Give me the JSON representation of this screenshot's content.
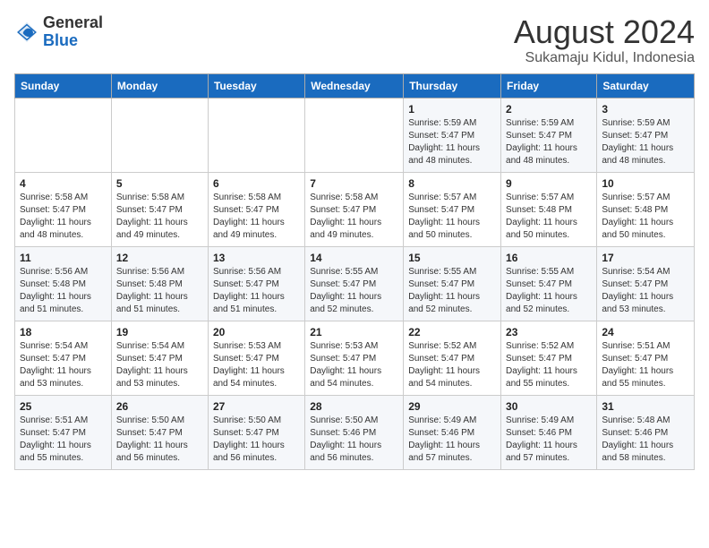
{
  "header": {
    "logo_general": "General",
    "logo_blue": "Blue",
    "month_year": "August 2024",
    "location": "Sukamaju Kidul, Indonesia"
  },
  "days_of_week": [
    "Sunday",
    "Monday",
    "Tuesday",
    "Wednesday",
    "Thursday",
    "Friday",
    "Saturday"
  ],
  "weeks": [
    [
      {
        "day": "",
        "info": ""
      },
      {
        "day": "",
        "info": ""
      },
      {
        "day": "",
        "info": ""
      },
      {
        "day": "",
        "info": ""
      },
      {
        "day": "1",
        "info": "Sunrise: 5:59 AM\nSunset: 5:47 PM\nDaylight: 11 hours and 48 minutes."
      },
      {
        "day": "2",
        "info": "Sunrise: 5:59 AM\nSunset: 5:47 PM\nDaylight: 11 hours and 48 minutes."
      },
      {
        "day": "3",
        "info": "Sunrise: 5:59 AM\nSunset: 5:47 PM\nDaylight: 11 hours and 48 minutes."
      }
    ],
    [
      {
        "day": "4",
        "info": "Sunrise: 5:58 AM\nSunset: 5:47 PM\nDaylight: 11 hours and 48 minutes."
      },
      {
        "day": "5",
        "info": "Sunrise: 5:58 AM\nSunset: 5:47 PM\nDaylight: 11 hours and 49 minutes."
      },
      {
        "day": "6",
        "info": "Sunrise: 5:58 AM\nSunset: 5:47 PM\nDaylight: 11 hours and 49 minutes."
      },
      {
        "day": "7",
        "info": "Sunrise: 5:58 AM\nSunset: 5:47 PM\nDaylight: 11 hours and 49 minutes."
      },
      {
        "day": "8",
        "info": "Sunrise: 5:57 AM\nSunset: 5:47 PM\nDaylight: 11 hours and 50 minutes."
      },
      {
        "day": "9",
        "info": "Sunrise: 5:57 AM\nSunset: 5:48 PM\nDaylight: 11 hours and 50 minutes."
      },
      {
        "day": "10",
        "info": "Sunrise: 5:57 AM\nSunset: 5:48 PM\nDaylight: 11 hours and 50 minutes."
      }
    ],
    [
      {
        "day": "11",
        "info": "Sunrise: 5:56 AM\nSunset: 5:48 PM\nDaylight: 11 hours and 51 minutes."
      },
      {
        "day": "12",
        "info": "Sunrise: 5:56 AM\nSunset: 5:48 PM\nDaylight: 11 hours and 51 minutes."
      },
      {
        "day": "13",
        "info": "Sunrise: 5:56 AM\nSunset: 5:47 PM\nDaylight: 11 hours and 51 minutes."
      },
      {
        "day": "14",
        "info": "Sunrise: 5:55 AM\nSunset: 5:47 PM\nDaylight: 11 hours and 52 minutes."
      },
      {
        "day": "15",
        "info": "Sunrise: 5:55 AM\nSunset: 5:47 PM\nDaylight: 11 hours and 52 minutes."
      },
      {
        "day": "16",
        "info": "Sunrise: 5:55 AM\nSunset: 5:47 PM\nDaylight: 11 hours and 52 minutes."
      },
      {
        "day": "17",
        "info": "Sunrise: 5:54 AM\nSunset: 5:47 PM\nDaylight: 11 hours and 53 minutes."
      }
    ],
    [
      {
        "day": "18",
        "info": "Sunrise: 5:54 AM\nSunset: 5:47 PM\nDaylight: 11 hours and 53 minutes."
      },
      {
        "day": "19",
        "info": "Sunrise: 5:54 AM\nSunset: 5:47 PM\nDaylight: 11 hours and 53 minutes."
      },
      {
        "day": "20",
        "info": "Sunrise: 5:53 AM\nSunset: 5:47 PM\nDaylight: 11 hours and 54 minutes."
      },
      {
        "day": "21",
        "info": "Sunrise: 5:53 AM\nSunset: 5:47 PM\nDaylight: 11 hours and 54 minutes."
      },
      {
        "day": "22",
        "info": "Sunrise: 5:52 AM\nSunset: 5:47 PM\nDaylight: 11 hours and 54 minutes."
      },
      {
        "day": "23",
        "info": "Sunrise: 5:52 AM\nSunset: 5:47 PM\nDaylight: 11 hours and 55 minutes."
      },
      {
        "day": "24",
        "info": "Sunrise: 5:51 AM\nSunset: 5:47 PM\nDaylight: 11 hours and 55 minutes."
      }
    ],
    [
      {
        "day": "25",
        "info": "Sunrise: 5:51 AM\nSunset: 5:47 PM\nDaylight: 11 hours and 55 minutes."
      },
      {
        "day": "26",
        "info": "Sunrise: 5:50 AM\nSunset: 5:47 PM\nDaylight: 11 hours and 56 minutes."
      },
      {
        "day": "27",
        "info": "Sunrise: 5:50 AM\nSunset: 5:47 PM\nDaylight: 11 hours and 56 minutes."
      },
      {
        "day": "28",
        "info": "Sunrise: 5:50 AM\nSunset: 5:46 PM\nDaylight: 11 hours and 56 minutes."
      },
      {
        "day": "29",
        "info": "Sunrise: 5:49 AM\nSunset: 5:46 PM\nDaylight: 11 hours and 57 minutes."
      },
      {
        "day": "30",
        "info": "Sunrise: 5:49 AM\nSunset: 5:46 PM\nDaylight: 11 hours and 57 minutes."
      },
      {
        "day": "31",
        "info": "Sunrise: 5:48 AM\nSunset: 5:46 PM\nDaylight: 11 hours and 58 minutes."
      }
    ]
  ]
}
